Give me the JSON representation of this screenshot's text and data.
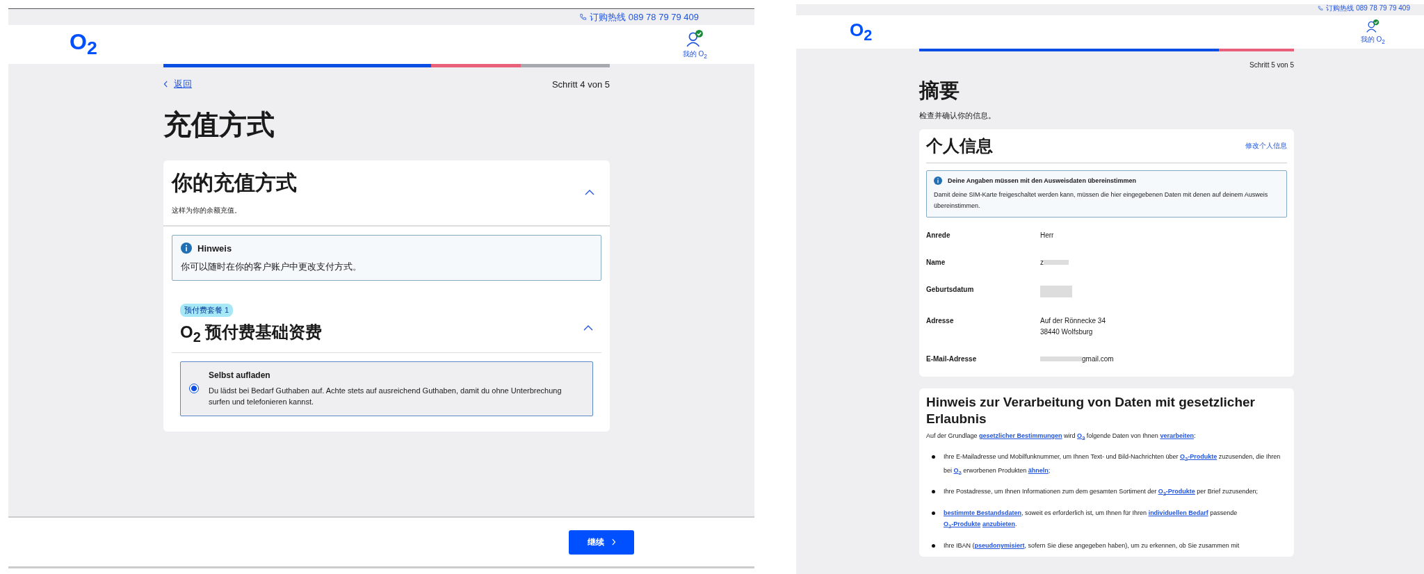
{
  "payment_screen": {
    "hotline": "订购热线 089 78 79 79 409",
    "logo": "O$_{2}$",
    "account_label": "我的 O$_{2}$",
    "progress": [
      {
        "kind": "done"
      },
      {
        "kind": "done"
      },
      {
        "kind": "done"
      },
      {
        "kind": "current"
      },
      {
        "kind": "todo"
      }
    ],
    "back_link": "返回",
    "step": "Schritt 4 von 5",
    "title": "充值方式",
    "card": {
      "title": "你的充值方式",
      "subtitle": "这样为你的余额充值。",
      "expanded": true,
      "notice": {
        "title": "Hinweis",
        "text": "你可以随时在你的客户账户中更改支付方式。"
      },
      "tariff": {
        "badge": "预付费套餐 1",
        "title": "O$_{2}$ 预付费基础资费",
        "expanded": true,
        "options": [
          {
            "title": "Selbst aufladen",
            "text": "Du lädst bei Bedarf Guthaben auf. Achte stets auf ausreichend Guthaben, damit du ohne Unterbrechung surfen und telefonieren kannst.",
            "selected": true
          }
        ]
      }
    },
    "continue_button": "继续"
  },
  "summary_screen": {
    "hotline": "订购热线 089 78 79 79 409",
    "logo": "O$_{2}$",
    "account_label": "我的 O$_{2}$",
    "progress": [
      {
        "kind": "done"
      },
      {
        "kind": "done"
      },
      {
        "kind": "done"
      },
      {
        "kind": "done"
      },
      {
        "kind": "current"
      }
    ],
    "step": "Schritt 5 von 5",
    "title": "摘要",
    "subtitle": "检查并确认你的信息。",
    "personal_card": {
      "title": "个人信息",
      "edit_link": "修改个人信息",
      "notice": {
        "title": "Deine Angaben müssen mit den Ausweisdaten übereinstimmen",
        "text": "Damit deine SIM-Karte freigeschaltet werden kann, müssen die hier eingegebenen Daten mit denen auf deinem Ausweis übereinstimmen."
      },
      "fields": [
        {
          "kind": "text",
          "label": "Anrede",
          "value_lines": [
            "Herr"
          ]
        },
        {
          "kind": "redacted_after",
          "label": "Name",
          "value_lines": [
            "z"
          ]
        },
        {
          "kind": "redacted",
          "label": "Geburtsdatum"
        },
        {
          "kind": "text",
          "label": "Adresse",
          "value_lines": [
            "Auf der Rönnecke 34",
            "38440 Wolfsburg"
          ]
        },
        {
          "kind": "redacted_before",
          "label": "E-Mail-Adresse",
          "value_lines": [
            "gmail.com"
          ]
        }
      ]
    },
    "legal_card": {
      "title": "Hinweis zur Verarbeitung von Daten mit gesetzlicher Erlaubnis",
      "intro": [
        {
          "text": "Auf der Grundlage ",
          "link": false
        },
        {
          "text": "gesetzlicher Bestimmungen",
          "link": true
        },
        {
          "text": " wird ",
          "link": false
        },
        {
          "text": "O$_{2}$",
          "link": true
        },
        {
          "text": " folgende Daten von Ihnen ",
          "link": false
        },
        {
          "text": "verarbeiten",
          "link": true
        },
        {
          "text": ":",
          "link": false
        }
      ],
      "bullets": [
        [
          {
            "text": "Ihre E-Mailadresse und Mobilfunknummer, um Ihnen Text- und Bild-Nachrichten über ",
            "link": false
          },
          {
            "text": "O$_{2}$-Produkte",
            "link": true
          },
          {
            "text": " zuzusenden, die Ihren bei ",
            "link": false
          },
          {
            "text": "O$_{2}$",
            "link": true
          },
          {
            "text": " erworbenen Produkten ",
            "link": false
          },
          {
            "text": "ähneln",
            "link": true
          },
          {
            "text": ";",
            "link": false
          }
        ],
        [
          {
            "text": "Ihre Postadresse, um Ihnen Informationen zum dem gesamten Sortiment der ",
            "link": false
          },
          {
            "text": "O$_{2}$-Produkte",
            "link": true
          },
          {
            "text": " per Brief zuzusenden;",
            "link": false
          }
        ],
        [
          {
            "text": "bestimmte Bestandsdaten",
            "link": true
          },
          {
            "text": ", soweit es erforderlich ist, um Ihnen für Ihren ",
            "link": false
          },
          {
            "text": "individuellen Bedarf",
            "link": true
          },
          {
            "text": " passende ",
            "link": false
          },
          {
            "text": "O$_{2}$-Produkte",
            "link": true
          },
          {
            "text": "anzubieten",
            "link": true
          },
          {
            "text": ".",
            "link": false
          }
        ],
        [
          {
            "text": "Ihre IBAN (",
            "link": false
          },
          {
            "text": "pseudonymisiert",
            "link": true
          },
          {
            "text": ", sofern Sie diese angegeben haben), um zu erkennen, ob Sie zusammen mit",
            "link": false
          }
        ]
      ]
    }
  }
}
